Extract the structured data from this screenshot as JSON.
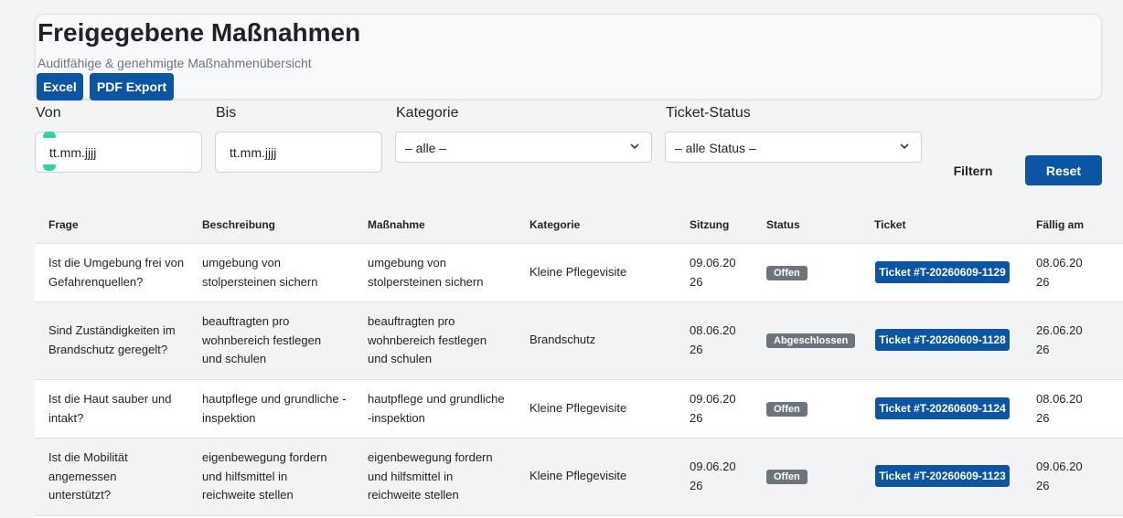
{
  "header": {
    "title": "Freigegebene Maßnahmen",
    "subtitle": "Auditfähige & genehmigte Maßnahmenübersicht",
    "excel_label": "Excel",
    "pdf_label": "PDF Export"
  },
  "filters": {
    "von_label": "Von",
    "bis_label": "Bis",
    "kategorie_label": "Kategorie",
    "status_label": "Ticket-Status",
    "von_value": "tt.mm.jjjj",
    "bis_value": "tt.mm.jjjj",
    "kategorie_value": "– alle –",
    "status_value": "– alle Status –",
    "filter_button": "Filtern",
    "reset_button": "Reset"
  },
  "table": {
    "headers": [
      "Frage",
      "Beschreibung",
      "Maßnahme",
      "Kategorie",
      "Sitzung",
      "Status",
      "Ticket",
      "Fällig am"
    ],
    "rows": [
      {
        "frage": "Ist die Umgebung frei von Gefahrenquellen?",
        "beschreibung": "umgebung von stolpersteinen sichern",
        "massnahme": "umgebung von stolpersteinen sichern",
        "kategorie": "Kleine Pflegevisite",
        "sitzung": "09.06.2026",
        "status": "Offen",
        "ticket": "Ticket #T-20260609-1129",
        "faellig": "08.06.2026"
      },
      {
        "frage": "Sind Zuständigkeiten im Brandschutz geregelt?",
        "beschreibung": "beauftragten pro wohnbereich festlegen und schulen",
        "massnahme": "beauftragten pro wohnbereich festlegen und schulen",
        "kategorie": "Brandschutz",
        "sitzung": "08.06.2026",
        "status": "Abgeschlossen",
        "ticket": "Ticket #T-20260609-1128",
        "faellig": "26.06.2026"
      },
      {
        "frage": "Ist die Haut sauber und intakt?",
        "beschreibung": "hautpflege und grundliche -inspektion",
        "massnahme": "hautpflege und grundliche -inspektion",
        "kategorie": "Kleine Pflegevisite",
        "sitzung": "09.06.2026",
        "status": "Offen",
        "ticket": "Ticket #T-20260609-1124",
        "faellig": "08.06.2026"
      },
      {
        "frage": "Ist die Mobilität angemessen unterstützt?",
        "beschreibung": "eigenbewegung fordern und hilfsmittel in reichweite stellen",
        "massnahme": "eigenbewegung fordern und hilfsmittel in reichweite stellen",
        "kategorie": "Kleine Pflegevisite",
        "sitzung": "09.06.2026",
        "status": "Offen",
        "ticket": "Ticket #T-20260609-1123",
        "faellig": "09.06.2026"
      }
    ]
  }
}
